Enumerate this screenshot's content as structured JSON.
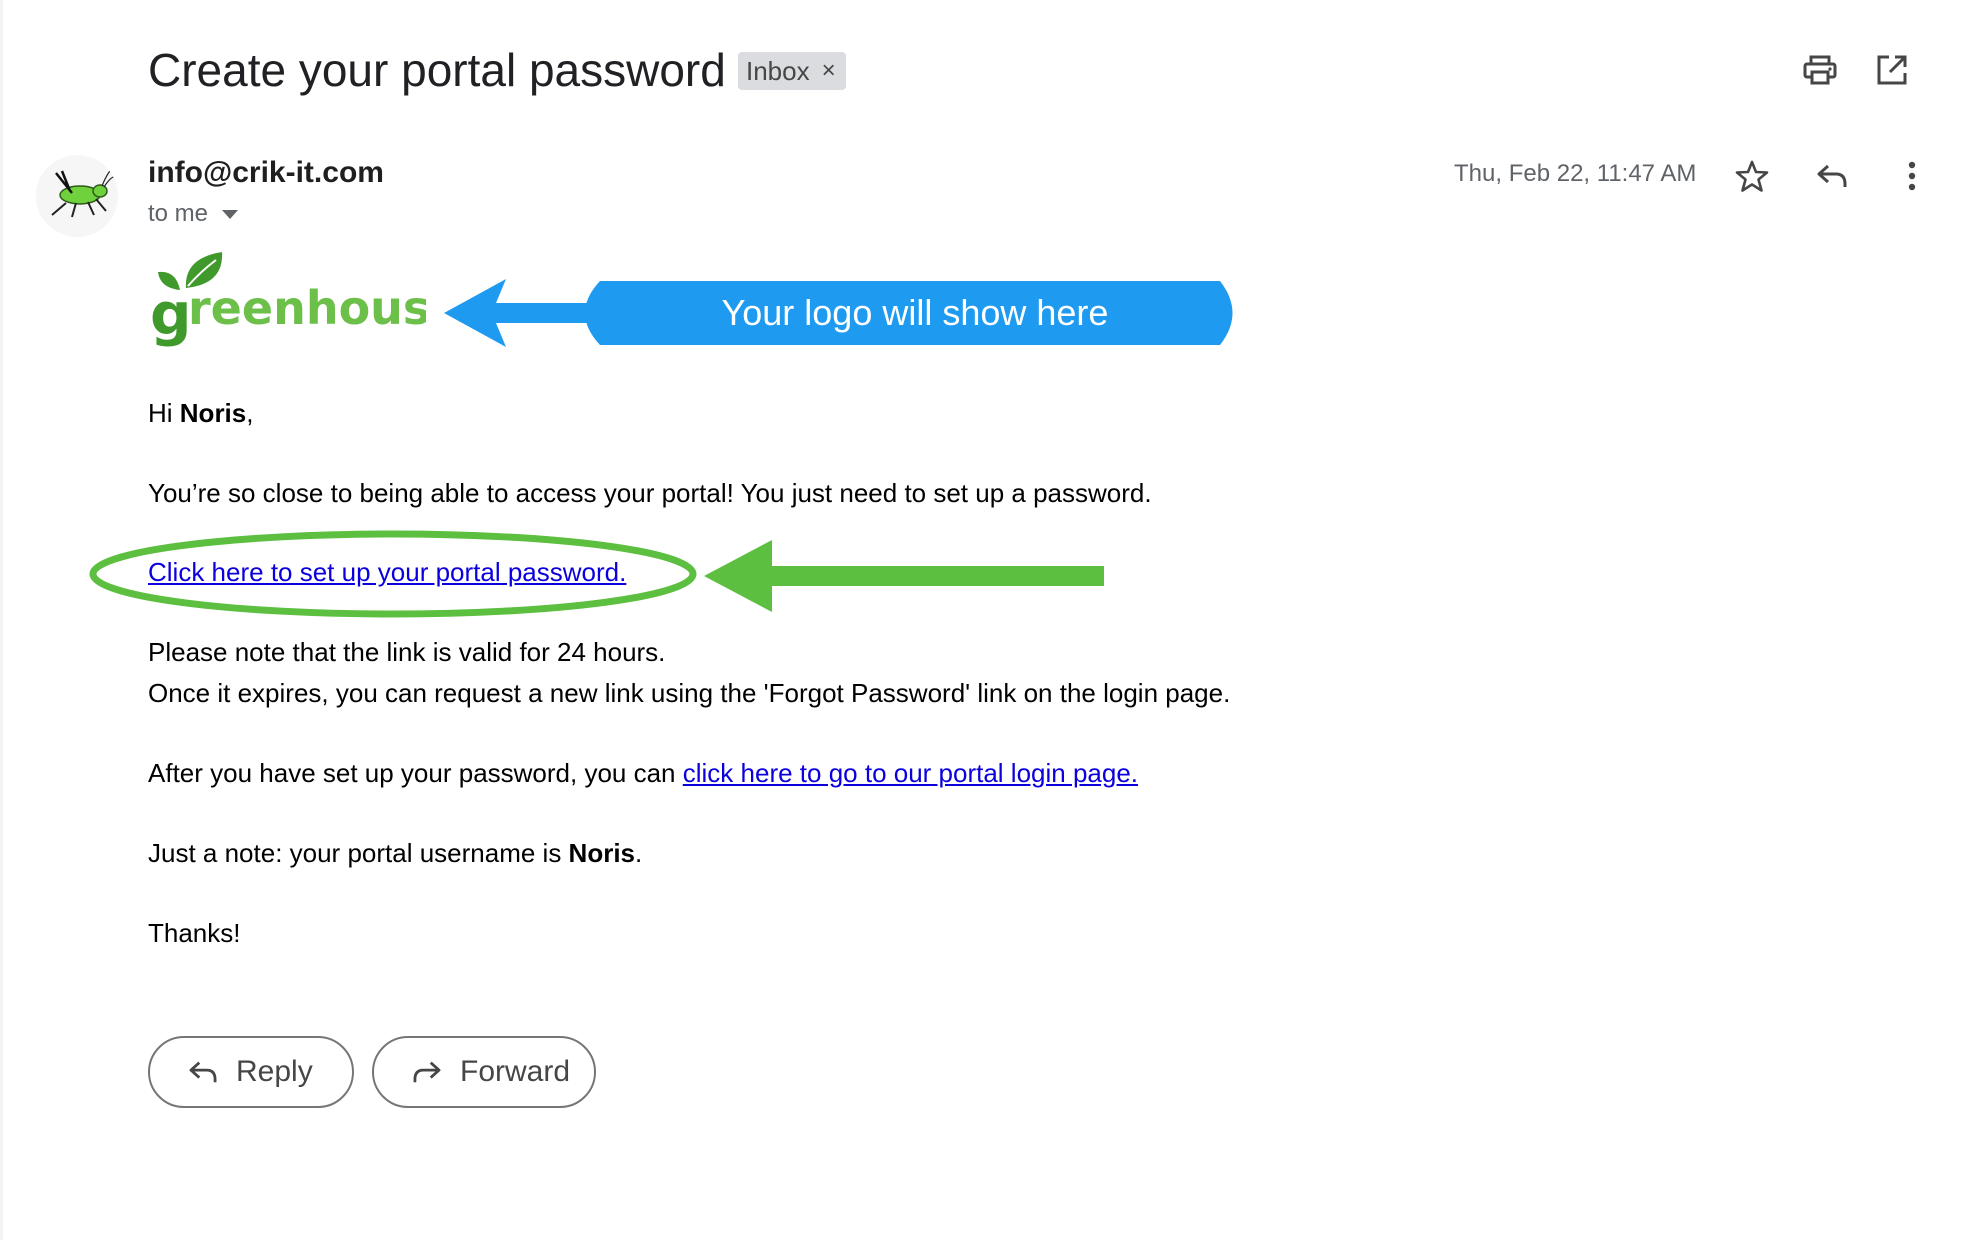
{
  "email": {
    "subject": "Create your portal password",
    "label_chip": "Inbox",
    "label_chip_close": "×",
    "sender": "info@crik-it.com",
    "recipient": "to me",
    "date": "Thu, Feb 22, 11:47 AM"
  },
  "logo": {
    "word_g": "g",
    "word_rest": "reenhouse"
  },
  "callout": {
    "text": "Your logo will show here",
    "color": "#1e9bf0"
  },
  "body": {
    "greeting_prefix": "Hi ",
    "greeting_name": "Noris",
    "greeting_suffix": ",",
    "line1": "You’re so close to being able to access your portal! You just need to set up a password.",
    "setup_link": "Click here to set up your portal password.",
    "note1": "Please note that the link is valid for 24 hours.",
    "note2": "Once it expires, you can request a new link using the 'Forgot Password' link on the login page.",
    "after_prefix": "After you have set up your password, you can ",
    "login_link": "click here to go to our portal login page.",
    "username_prefix": "Just a note: your portal username is ",
    "username": "Noris",
    "username_suffix": ".",
    "thanks": "Thanks!"
  },
  "actions": {
    "reply": "Reply",
    "forward": "Forward"
  },
  "icons": {
    "print": "print-icon",
    "open_new_window": "open-in-new-icon",
    "star": "star-icon",
    "reply": "reply-icon",
    "more": "more-vert-icon",
    "forward": "forward-icon"
  },
  "colors": {
    "highlight_green": "#5cbf3f",
    "link": "#0b00dd"
  }
}
